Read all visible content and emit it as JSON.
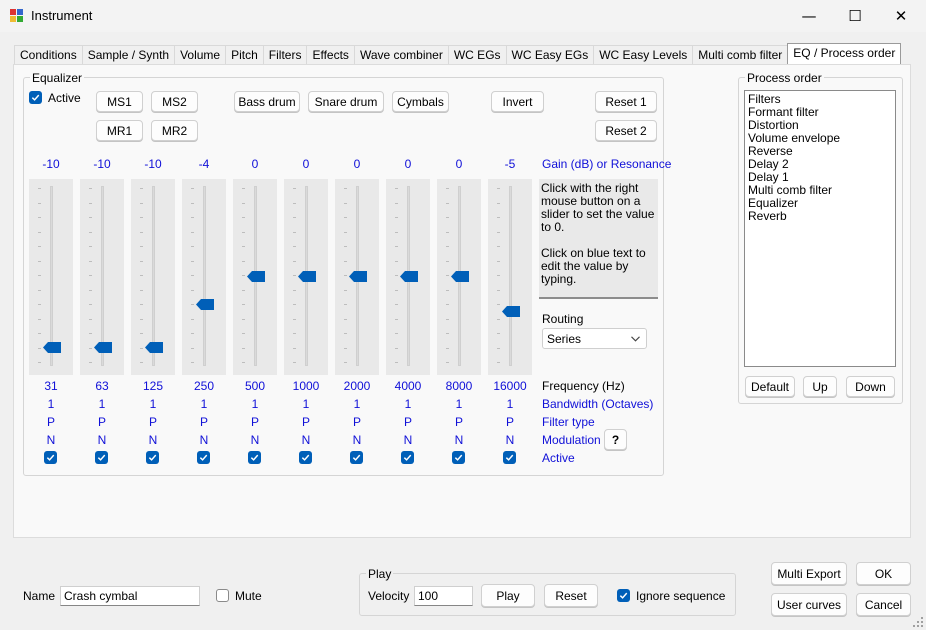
{
  "window": {
    "title": "Instrument",
    "minimize_glyph": "—",
    "maximize_glyph": "☐",
    "close_glyph": "✕"
  },
  "tabs": [
    "Conditions",
    "Sample / Synth",
    "Volume",
    "Pitch",
    "Filters",
    "Effects",
    "Wave combiner",
    "WC EGs",
    "WC Easy EGs",
    "WC Easy Levels",
    "Multi comb filter",
    "EQ / Process order"
  ],
  "active_tab": "EQ / Process order",
  "equalizer": {
    "group_label": "Equalizer",
    "active_label": "Active",
    "active_checked": true,
    "buttons": {
      "ms1": "MS1",
      "ms2": "MS2",
      "mr1": "MR1",
      "mr2": "MR2",
      "bass_drum": "Bass drum",
      "snare_drum": "Snare drum",
      "cymbals": "Cymbals",
      "invert": "Invert",
      "reset1": "Reset 1",
      "reset2": "Reset 2",
      "help": "?"
    },
    "gain_label": "Gain (dB) or Resonance",
    "frequency_label": "Frequency (Hz)",
    "bandwidth_label": "Bandwidth (Octaves)",
    "filter_type_label": "Filter type",
    "modulation_label": "Modulation",
    "active_row_label": "Active",
    "info_text": "Click with the right mouse button on a slider to set the value to 0.",
    "info_text2": "Click on blue text to edit the value by typing.",
    "routing_label": "Routing",
    "routing_value": "Series",
    "slider_min": -12,
    "slider_max": 12,
    "bands": [
      {
        "gain": "-10",
        "gain_value": -10,
        "frequency": "31",
        "bandwidth": "1",
        "filter_type": "P",
        "modulation": "N",
        "active": true
      },
      {
        "gain": "-10",
        "gain_value": -10,
        "frequency": "63",
        "bandwidth": "1",
        "filter_type": "P",
        "modulation": "N",
        "active": true
      },
      {
        "gain": "-10",
        "gain_value": -10,
        "frequency": "125",
        "bandwidth": "1",
        "filter_type": "P",
        "modulation": "N",
        "active": true
      },
      {
        "gain": "-4",
        "gain_value": -4,
        "frequency": "250",
        "bandwidth": "1",
        "filter_type": "P",
        "modulation": "N",
        "active": true
      },
      {
        "gain": "0",
        "gain_value": 0,
        "frequency": "500",
        "bandwidth": "1",
        "filter_type": "P",
        "modulation": "N",
        "active": true
      },
      {
        "gain": "0",
        "gain_value": 0,
        "frequency": "1000",
        "bandwidth": "1",
        "filter_type": "P",
        "modulation": "N",
        "active": true
      },
      {
        "gain": "0",
        "gain_value": 0,
        "frequency": "2000",
        "bandwidth": "1",
        "filter_type": "P",
        "modulation": "N",
        "active": true
      },
      {
        "gain": "0",
        "gain_value": 0,
        "frequency": "4000",
        "bandwidth": "1",
        "filter_type": "P",
        "modulation": "N",
        "active": true
      },
      {
        "gain": "0",
        "gain_value": 0,
        "frequency": "8000",
        "bandwidth": "1",
        "filter_type": "P",
        "modulation": "N",
        "active": true
      },
      {
        "gain": "-5",
        "gain_value": -5,
        "frequency": "16000",
        "bandwidth": "1",
        "filter_type": "P",
        "modulation": "N",
        "active": true
      }
    ]
  },
  "process_order": {
    "group_label": "Process order",
    "items": [
      "Filters",
      "Formant filter",
      "Distortion",
      "Volume envelope",
      "Reverse",
      "Delay 2",
      "Delay 1",
      "Multi comb filter",
      "Equalizer",
      "Reverb"
    ],
    "default_label": "Default",
    "up_label": "Up",
    "down_label": "Down"
  },
  "bottom": {
    "name_label": "Name",
    "name_value": "Crash cymbal",
    "mute_label": "Mute",
    "mute_checked": false,
    "play_group_label": "Play",
    "velocity_label": "Velocity",
    "velocity_value": "100",
    "play_button": "Play",
    "reset_button": "Reset",
    "ignore_sequence_label": "Ignore sequence",
    "ignore_sequence_checked": true,
    "multi_export": "Multi Export",
    "ok": "OK",
    "user_curves": "User curves",
    "cancel": "Cancel"
  },
  "colors": {
    "accent": "#005fb8",
    "blue_text": "#1010d8"
  }
}
